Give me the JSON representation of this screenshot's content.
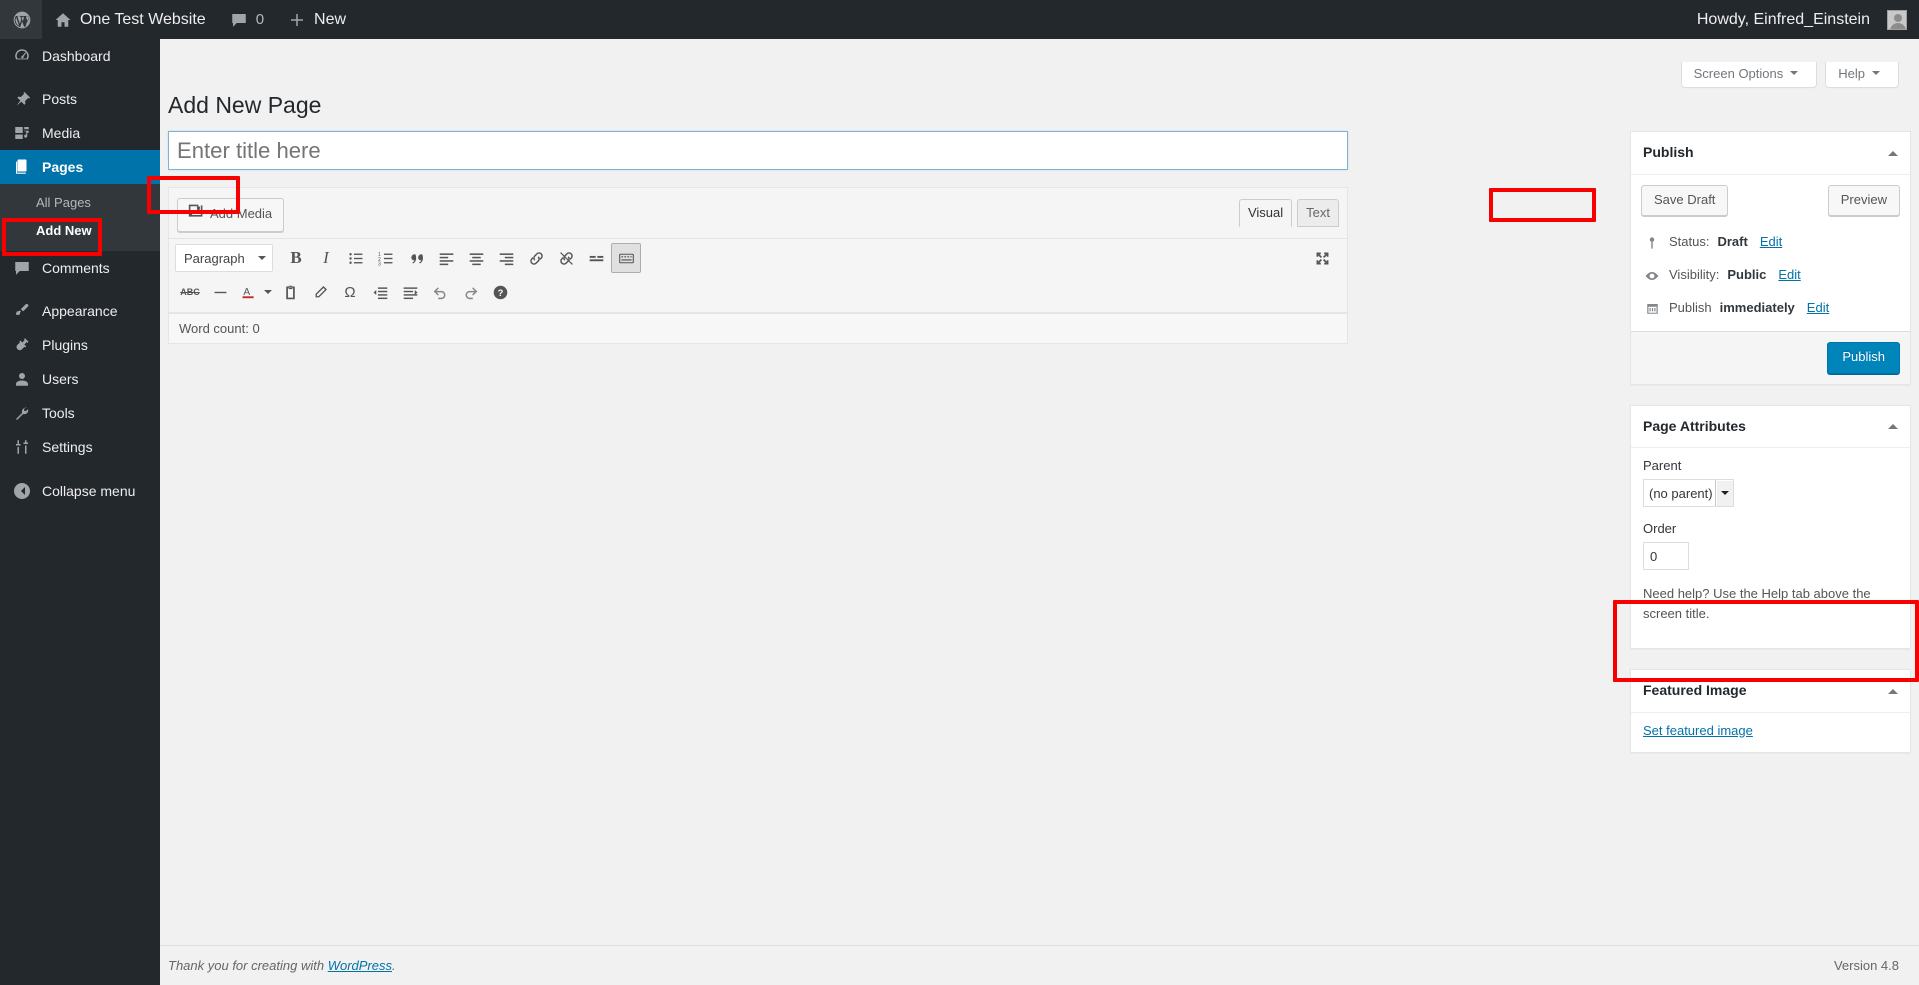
{
  "adminbar": {
    "logo_icon": "wordpress-logo-icon",
    "site_name": "One Test Website",
    "site_icon": "home-icon",
    "comments_icon": "comment-bubble-icon",
    "comments_count": "0",
    "new_icon": "plus-icon",
    "new_label": "New",
    "howdy": "Howdy, Einfred_Einstein",
    "avatar_icon": "user-avatar-icon"
  },
  "sidebar": {
    "items": [
      {
        "label": "Dashboard",
        "icon": "dashboard-gauge-icon",
        "current": false
      },
      {
        "label": "Posts",
        "icon": "pushpin-icon",
        "current": false
      },
      {
        "label": "Media",
        "icon": "media-music-icon",
        "current": false
      },
      {
        "label": "Pages",
        "icon": "pages-stack-icon",
        "current": true
      },
      {
        "label": "Comments",
        "icon": "comment-bubble-icon",
        "current": false
      },
      {
        "label": "Appearance",
        "icon": "paintbrush-icon",
        "current": false
      },
      {
        "label": "Plugins",
        "icon": "plug-icon",
        "current": false
      },
      {
        "label": "Users",
        "icon": "user-icon",
        "current": false
      },
      {
        "label": "Tools",
        "icon": "wrench-icon",
        "current": false
      },
      {
        "label": "Settings",
        "icon": "sliders-icon",
        "current": false
      }
    ],
    "submenu": [
      {
        "label": "All Pages",
        "current": false
      },
      {
        "label": "Add New",
        "current": true
      }
    ],
    "collapse": {
      "label": "Collapse menu",
      "icon": "collapse-arrow-icon"
    }
  },
  "screen_meta": {
    "screen_options": "Screen Options",
    "help": "Help"
  },
  "page": {
    "title": "Add New Page",
    "title_input_value": "",
    "title_input_placeholder": "Enter title here"
  },
  "editor": {
    "add_media_label": "Add Media",
    "add_media_icon": "add-media-icon",
    "tabs": [
      {
        "label": "Visual",
        "active": true
      },
      {
        "label": "Text",
        "active": false
      }
    ],
    "format_select": "Paragraph",
    "toolbar_row1": [
      {
        "name": "bold-icon",
        "glyph": "B"
      },
      {
        "name": "italic-icon",
        "glyph": "I"
      },
      {
        "name": "bulleted-list-icon",
        "glyph": ""
      },
      {
        "name": "numbered-list-icon",
        "glyph": ""
      },
      {
        "name": "blockquote-icon",
        "glyph": ""
      },
      {
        "name": "align-left-icon",
        "glyph": ""
      },
      {
        "name": "align-center-icon",
        "glyph": ""
      },
      {
        "name": "align-right-icon",
        "glyph": ""
      },
      {
        "name": "insert-link-icon",
        "glyph": ""
      },
      {
        "name": "remove-link-icon",
        "glyph": ""
      },
      {
        "name": "insert-read-more-icon",
        "glyph": ""
      },
      {
        "name": "toolbar-toggle-icon",
        "glyph": ""
      }
    ],
    "toolbar_row2": [
      {
        "name": "strikethrough-icon",
        "glyph": "ABC"
      },
      {
        "name": "horizontal-line-icon",
        "glyph": ""
      },
      {
        "name": "text-color-icon",
        "glyph": "A"
      },
      {
        "name": "paste-as-text-icon",
        "glyph": ""
      },
      {
        "name": "clear-formatting-icon",
        "glyph": ""
      },
      {
        "name": "special-character-icon",
        "glyph": "Ω"
      },
      {
        "name": "outdent-icon",
        "glyph": ""
      },
      {
        "name": "indent-icon",
        "glyph": ""
      },
      {
        "name": "undo-icon",
        "glyph": ""
      },
      {
        "name": "redo-icon",
        "glyph": ""
      },
      {
        "name": "keyboard-shortcuts-icon",
        "glyph": "?"
      }
    ],
    "distraction_free_icon": "distraction-free-writing-icon",
    "content_value": "",
    "word_count_label": "Word count: 0"
  },
  "publish_box": {
    "title": "Publish",
    "toggle_icon": "toggle-arrow-up-icon",
    "save_draft": "Save Draft",
    "preview": "Preview",
    "status_icon": "pin-icon",
    "status_label": "Status:",
    "status_value": "Draft",
    "status_edit": "Edit",
    "visibility_icon": "eye-icon",
    "visibility_label": "Visibility:",
    "visibility_value": "Public",
    "visibility_edit": "Edit",
    "schedule_icon": "calendar-icon",
    "schedule_label": "Publish",
    "schedule_value": "immediately",
    "schedule_edit": "Edit",
    "publish_button": "Publish"
  },
  "page_attributes_box": {
    "title": "Page Attributes",
    "toggle_icon": "toggle-arrow-up-icon",
    "parent_label": "Parent",
    "parent_value": "(no parent)",
    "order_label": "Order",
    "order_value": "0",
    "help_text": "Need help? Use the Help tab above the screen title."
  },
  "featured_image_box": {
    "title": "Featured Image",
    "toggle_icon": "toggle-arrow-up-icon",
    "set_link": "Set featured image"
  },
  "footer": {
    "thanks_prefix": "Thank you for creating with ",
    "thanks_link": "WordPress",
    "thanks_suffix": ".",
    "version": "Version 4.8"
  },
  "highlights": {
    "accent_color": "#f90000",
    "boxes": [
      "add-new-menu",
      "add-media-button",
      "visual-text-tabs",
      "featured-image-box"
    ]
  }
}
